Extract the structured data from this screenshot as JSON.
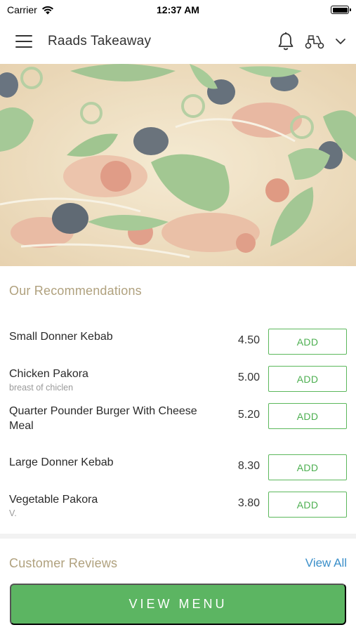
{
  "status_bar": {
    "carrier": "Carrier",
    "time": "12:37 AM"
  },
  "header": {
    "title": "Raads Takeaway",
    "icons": [
      "menu-icon",
      "bell-icon",
      "scooter-icon",
      "chevron-down-icon"
    ]
  },
  "hero": {
    "image": "pizza-with-basil-and-olives"
  },
  "recommendations": {
    "title": "Our Recommendations",
    "add_label": "ADD",
    "items": [
      {
        "name": "Small Donner Kebab",
        "description": "",
        "price": "4.50"
      },
      {
        "name": "Chicken Pakora",
        "description": "breast of chiclen",
        "price": "5.00"
      },
      {
        "name": "Quarter Pounder Burger With Cheese Meal",
        "description": "",
        "price": "5.20"
      },
      {
        "name": "Large Donner Kebab",
        "description": "",
        "price": "8.30"
      },
      {
        "name": "Vegetable Pakora",
        "description": "V.",
        "price": "3.80"
      }
    ]
  },
  "reviews": {
    "title": "Customer Reviews",
    "view_all_label": "View All"
  },
  "footer": {
    "view_menu_label": "VIEW MENU"
  },
  "colors": {
    "accent_green": "#5cb562",
    "section_title": "#b0a17e",
    "link_blue": "#3b8fc9"
  }
}
